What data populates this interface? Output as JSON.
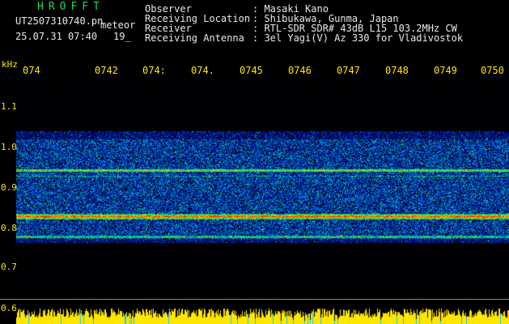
{
  "header": {
    "brand": "HROFFT",
    "filename": "UT2507310740.pn",
    "meteor_label": "meteor",
    "datetime": "25.07.31 07:40",
    "meteor_count": "19_",
    "info_labels": [
      "Observer",
      "Receiving Location",
      "Receiver",
      "Receiving Antenna"
    ],
    "info_values": [
      ": Masaki Kano",
      ": Shibukawa, Gunma, Japan",
      ": RTL-SDR SDR# 43dB L15 103.2MHz CW",
      ": 3el Yagi(V) Az 330 for Vladivostok"
    ]
  },
  "axis": {
    "unit": "kHz",
    "y_labels": [
      "1.1",
      "1.0",
      "0.9",
      "0.8",
      "0.7",
      "0.6"
    ],
    "time_labels": [
      "074",
      "0742",
      "074:",
      "074.",
      "0745",
      "0746",
      "0747",
      "0748",
      "0749",
      "0750"
    ]
  },
  "colors": {
    "background": "#000000",
    "brand": "#1fd94a",
    "axis_text": "#ffe600",
    "header_text": "#e8e8e8",
    "bars": "#ffe600",
    "bar_gaps": "#19c8ff"
  }
}
